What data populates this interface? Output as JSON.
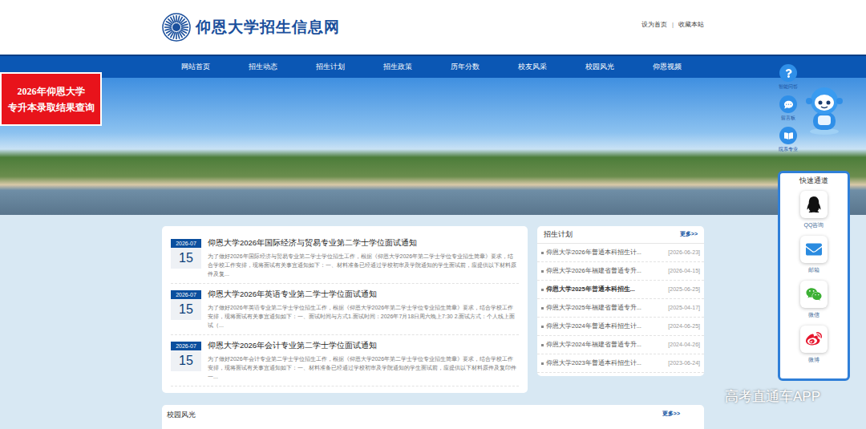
{
  "header": {
    "logo_text": "仰恩大学招生信息网",
    "links": [
      "设为首页",
      "收藏本站"
    ],
    "separator": "|"
  },
  "nav": {
    "items": [
      "网站首页",
      "招生动态",
      "招生计划",
      "招生政策",
      "历年分数",
      "校友风采",
      "校园风光",
      "仰恩视频"
    ]
  },
  "promo": {
    "lines": [
      "2026年仰恩大学",
      "专升本录取结果查询"
    ]
  },
  "float_tools": [
    {
      "label": "智能问答"
    },
    {
      "label": "留言板"
    },
    {
      "label": "院系专业"
    }
  ],
  "news": [
    {
      "month": "2026-07",
      "day": "15",
      "title": "仰恩大学2026年国际经济与贸易专业第二学士学位面试通知",
      "summary": "为了做好2026年国际经济与贸易专业第二学士学位招生工作，根据《仰恩大学2026年第二学士学位专业招生简章》要求，结合学校工作安排，现将面试有关事宜通知如下：一、材料准备已经通过学校初审及学院通知的学生面试前，应提供以下材料原件及复..."
    },
    {
      "month": "2026-07",
      "day": "15",
      "title": "仰恩大学2026年英语专业第二学士学位面试通知",
      "summary": "为了做好2026年英语专业第二学士学位招生工作，根据《仰恩大学2026年第二学士学位专业招生简章》要求，结合学校工作安排，现将面试有关事宜通知如下：一、面试时间与方式1.面试时间：2026年7月18日周六晚上7:30 2.面试方式：个人线上面试（..."
    },
    {
      "month": "2026-07",
      "day": "15",
      "title": "仰恩大学2026年会计专业第二学士学位面试通知",
      "summary": "为了做好2026年会计专业第二学士学位招生工作，根据《仰恩大学2026年第二学士学位专业招生简章》要求，结合学校工作安排，现将面试有关事宜通知如下：一、材料准备已经通过学校初审及学院通知的学生面试前，应提供以下材料原件及复印件一..."
    }
  ],
  "plan": {
    "title": "招生计划",
    "more": "更多>>",
    "items": [
      {
        "title": "仰恩大学2026年普通本科招生计...",
        "date": "[2026-06-23]",
        "bold": false
      },
      {
        "title": "仰恩大学2026年福建省普通专升...",
        "date": "[2026-04-15]",
        "bold": false
      },
      {
        "title": "仰恩大学2025年普通本科招生...",
        "date": "[2025-06-25]",
        "bold": true
      },
      {
        "title": "仰恩大学2025年福建省普通专升...",
        "date": "[2025-04-17]",
        "bold": false
      },
      {
        "title": "仰恩大学2024年普通本科招生计...",
        "date": "[2024-06-25]",
        "bold": false
      },
      {
        "title": "仰恩大学2024年福建省普通专升...",
        "date": "[2024-04-26]",
        "bold": false
      },
      {
        "title": "仰恩大学2023年普通本科招生计...",
        "date": "[2023-06-24]",
        "bold": false
      }
    ]
  },
  "campus": {
    "title": "校园风光",
    "more": "更多>>"
  },
  "quick": {
    "title": "快速通道",
    "items": [
      {
        "label": "QQ咨询"
      },
      {
        "label": "邮箱"
      },
      {
        "label": "微信"
      },
      {
        "label": "微博"
      }
    ]
  },
  "watermark": "高考直通车APP"
}
